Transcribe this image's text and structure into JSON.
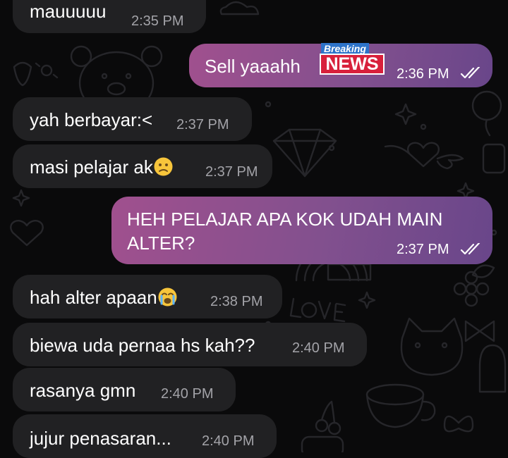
{
  "chat": {
    "messages": [
      {
        "text": "mauuuuu",
        "time": "2:35 PM",
        "direction": "incoming"
      },
      {
        "text": "Sell yaaahh",
        "time": "2:36 PM",
        "direction": "outgoing",
        "status": "read",
        "sticker": {
          "top": "Breaking",
          "main": "NEWS"
        }
      },
      {
        "text": "yah berbayar:<",
        "time": "2:37 PM",
        "direction": "incoming"
      },
      {
        "text": "masi pelajar ak",
        "time": "2:37 PM",
        "direction": "incoming",
        "emoji": "confused-face"
      },
      {
        "text_line1": "HEH PELAJAR APA KOK UDAH MAIN",
        "text_line2": "ALTER?",
        "time": "2:37 PM",
        "direction": "outgoing",
        "status": "read"
      },
      {
        "text": "hah alter apaan",
        "time": "2:38 PM",
        "direction": "incoming",
        "emoji": "loudly-crying-face"
      },
      {
        "text": "biewa uda pernaa hs kah??",
        "time": "2:40 PM",
        "direction": "incoming"
      },
      {
        "text": "rasanya gmn",
        "time": "2:40 PM",
        "direction": "incoming"
      },
      {
        "text": "jujur penasaran...",
        "time": "2:40 PM",
        "direction": "incoming"
      }
    ]
  },
  "colors": {
    "background": "#0a0a0b",
    "incoming_bubble": "#212123",
    "outgoing_gradient_start": "#a0508e",
    "outgoing_gradient_end": "#69468a",
    "incoming_time": "#a3a3a8"
  },
  "icons": {
    "read_receipt": "double-check-icon",
    "wallpaper": "doodle-pattern"
  }
}
